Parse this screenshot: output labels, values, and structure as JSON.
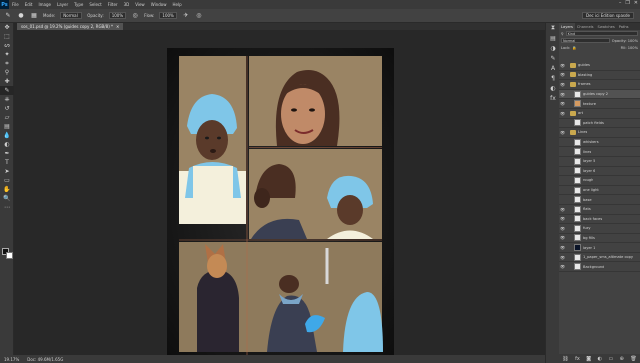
{
  "menubar": {
    "logo": "Ps",
    "items": [
      "File",
      "Edit",
      "Image",
      "Layer",
      "Type",
      "Select",
      "Filter",
      "3D",
      "View",
      "Window",
      "Help"
    ],
    "window_controls": [
      "–",
      "❐",
      "✕"
    ]
  },
  "options": {
    "mode_label": "Mode:",
    "mode_value": "Normal",
    "opacity_label": "Opacity:",
    "opacity_value": "100%",
    "flow_label": "Flow:",
    "flow_value": "100%",
    "workspace_value": "Dec ici Edition spasde"
  },
  "document": {
    "tab_label": "sos_01.psd @ 19.2% (guides copy 2, RGB/8) *",
    "close": "✕"
  },
  "status": {
    "zoom": "19.17%",
    "doc_info": "Doc: 49.6M/1.65G"
  },
  "panel": {
    "tabs": [
      "Layers",
      "Channels",
      "Swatches",
      "Paths"
    ],
    "kind_label": "Kind",
    "blend_value": "Normal",
    "opacity_label": "Opacity: 100%",
    "lock_label": "Lock:",
    "fill_label": "Fill: 100%",
    "layers": [
      {
        "name": "guides",
        "type": "folder",
        "visible": true
      },
      {
        "name": "blasting",
        "type": "folder",
        "visible": true
      },
      {
        "name": "frames",
        "type": "folder",
        "visible": true
      },
      {
        "name": "guides copy 2",
        "type": "layer",
        "visible": true,
        "selected": true
      },
      {
        "name": "texture",
        "type": "layer",
        "visible": true,
        "thumb": "#d59a60"
      },
      {
        "name": "art",
        "type": "folder",
        "visible": true
      },
      {
        "name": "patch fields",
        "type": "layer",
        "visible": false
      },
      {
        "name": "Lines",
        "type": "folder",
        "visible": true
      },
      {
        "name": "whiskers",
        "type": "layer",
        "visible": false
      },
      {
        "name": "lines",
        "type": "layer",
        "visible": false
      },
      {
        "name": "layer 5",
        "type": "layer",
        "visible": false
      },
      {
        "name": "layer 6",
        "type": "layer",
        "visible": false
      },
      {
        "name": "rough",
        "type": "layer",
        "visible": false
      },
      {
        "name": "one light",
        "type": "layer",
        "visible": false
      },
      {
        "name": "base",
        "type": "layer",
        "visible": false
      },
      {
        "name": "flats",
        "type": "layer",
        "visible": true
      },
      {
        "name": "back faces",
        "type": "layer",
        "visible": true
      },
      {
        "name": "fuzy",
        "type": "layer",
        "visible": true
      },
      {
        "name": "bg fills",
        "type": "layer",
        "visible": true
      },
      {
        "name": "layer 1",
        "type": "layer",
        "visible": true,
        "thumb": "#0a1428"
      },
      {
        "name": "1_paper_sms_altimate copy",
        "type": "layer",
        "visible": true
      },
      {
        "name": "Background",
        "type": "layer",
        "visible": true
      }
    ],
    "footer_icons": [
      "link-icon",
      "fx-icon",
      "mask-icon",
      "adjust-icon",
      "folder-icon",
      "new-layer-icon",
      "trash-icon"
    ]
  }
}
